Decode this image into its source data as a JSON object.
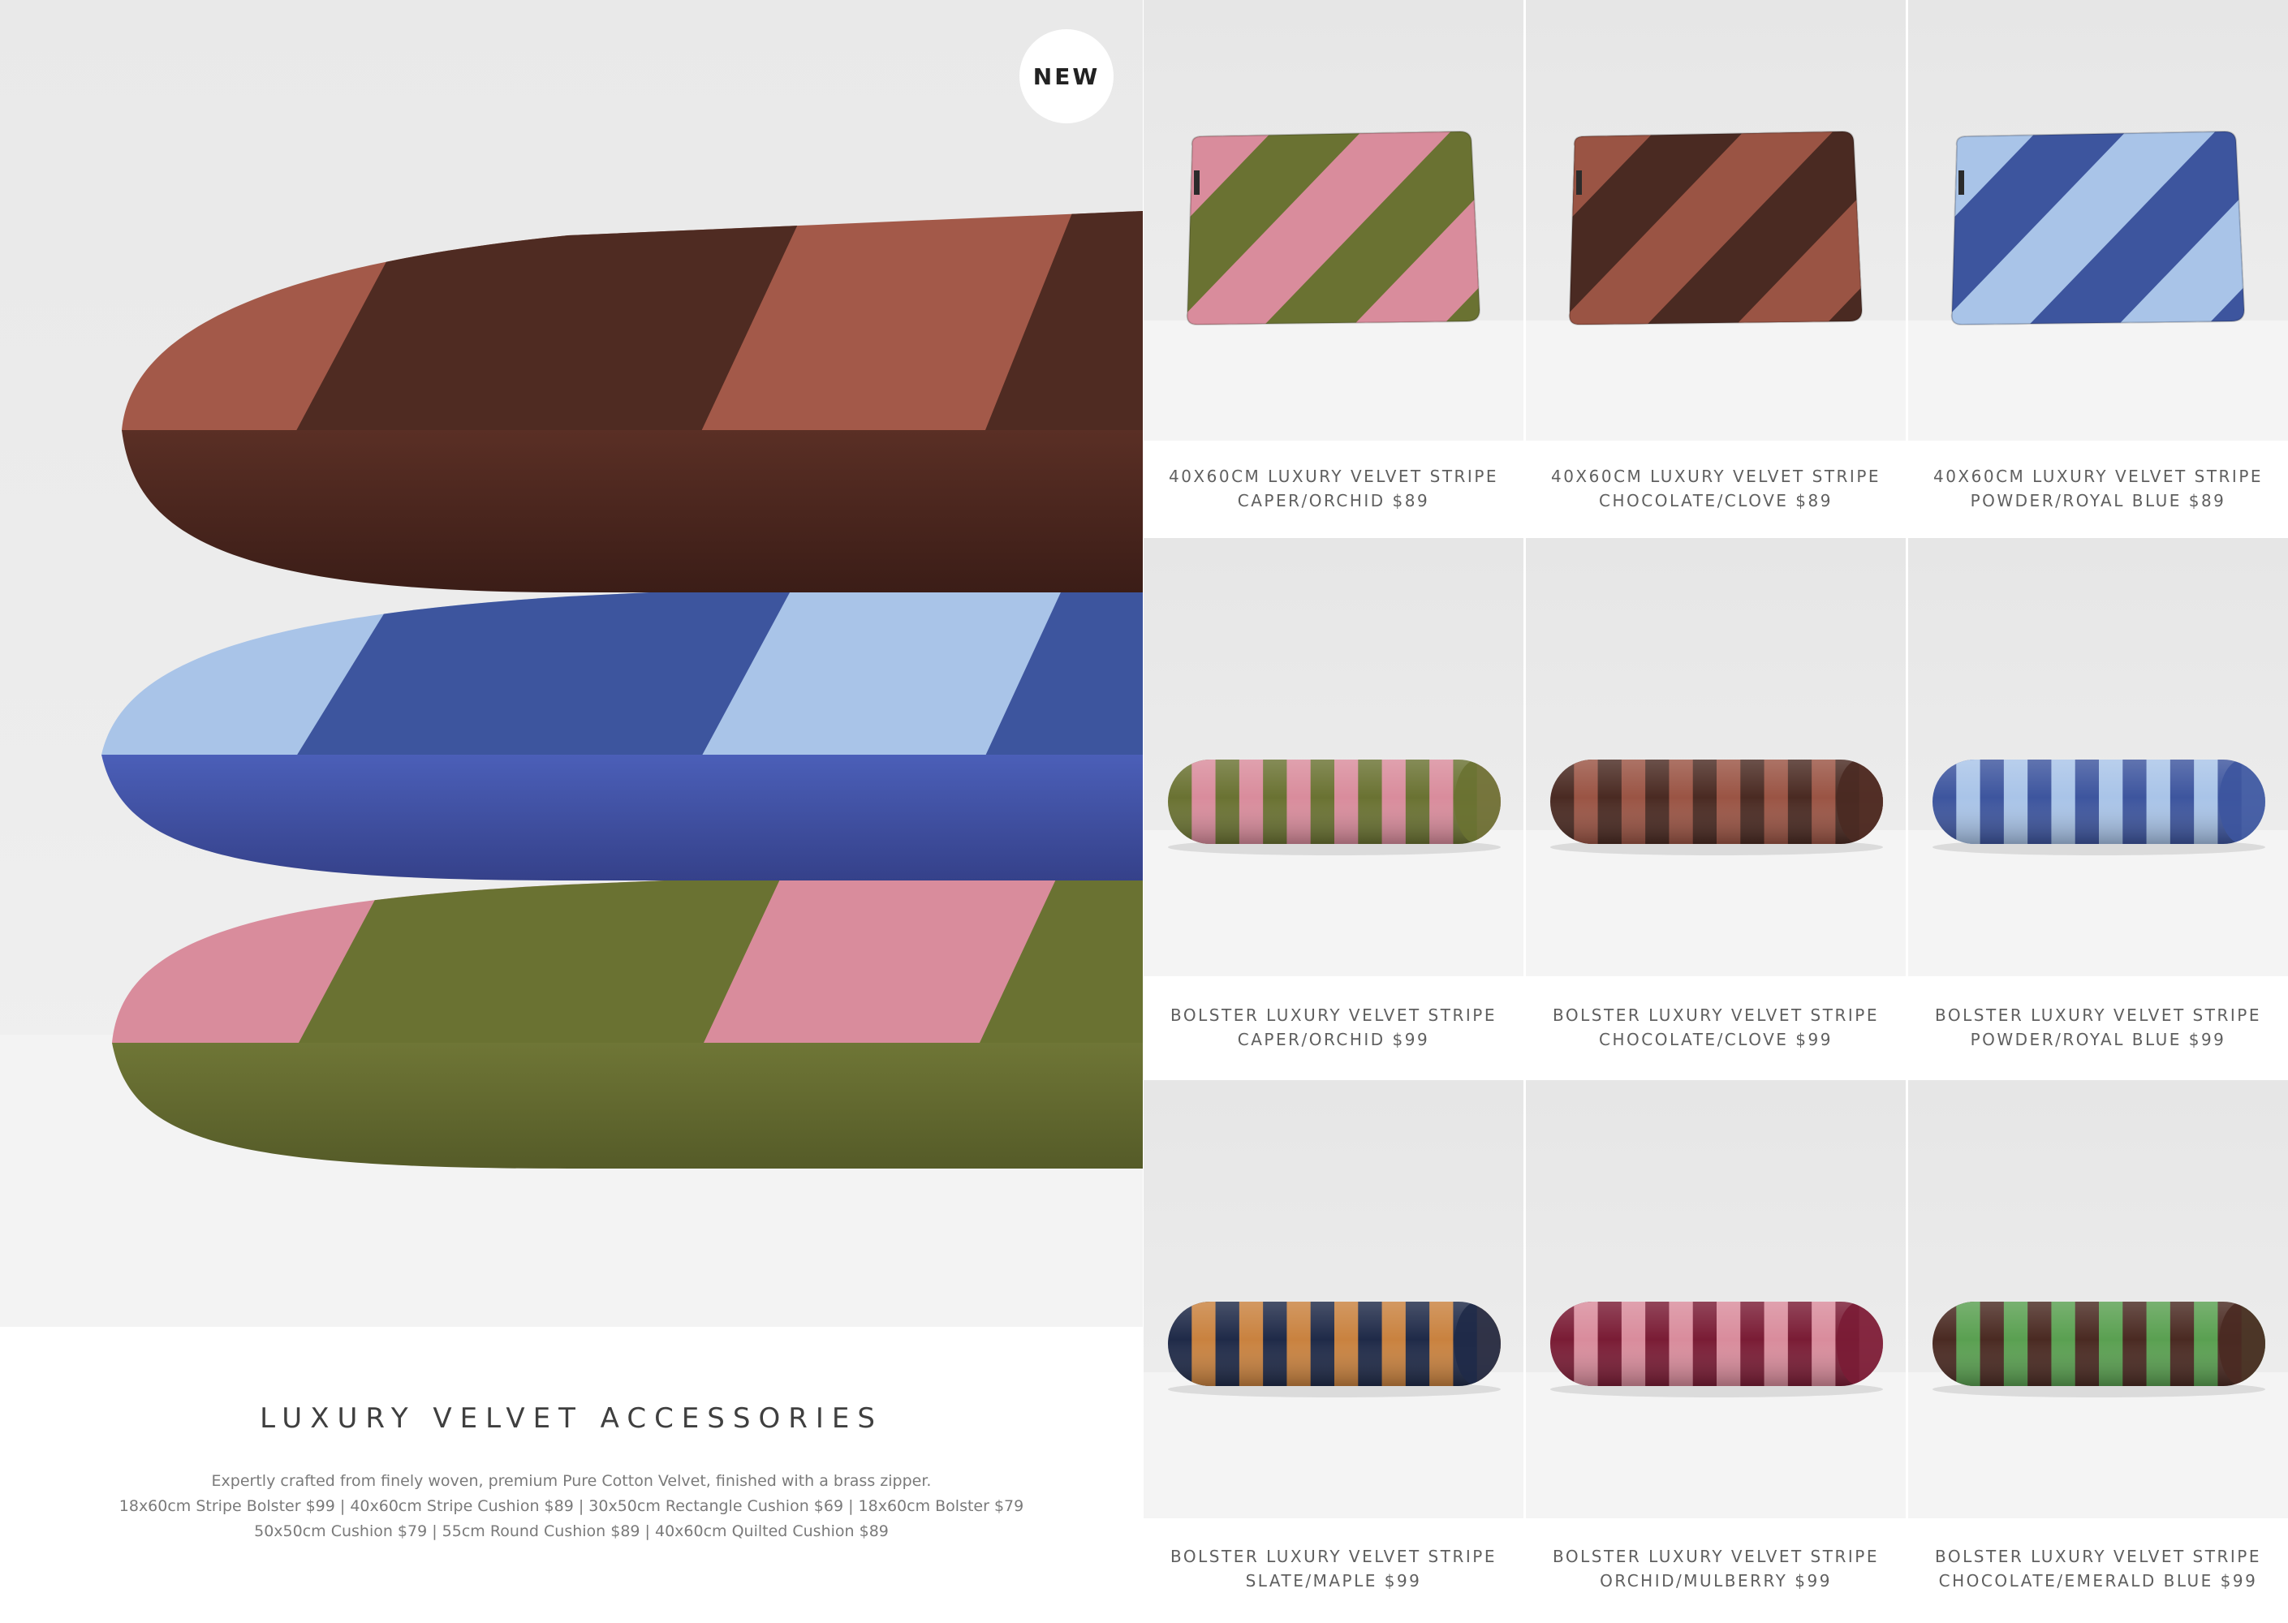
{
  "badge": "NEW",
  "intro": {
    "title": "LUXURY VELVET ACCESSORIES",
    "lines": [
      "Expertly crafted from finely woven, premium Pure Cotton Velvet, finished with a brass zipper.",
      "18x60cm Stripe Bolster $99  |  40x60cm Stripe Cushion $89  |  30x50cm Rectangle Cushion $69 | 18x60cm Bolster $79",
      "50x50cm Cushion $79  |  55cm Round Cushion $89  |  40x60cm Quilted Cushion $89"
    ]
  },
  "products": [
    {
      "line1": "40X60CM LUXURY VELVET STRIPE",
      "line2": "CAPER/ORCHID $89",
      "colors": [
        "#6a7232",
        "#d98c9c"
      ]
    },
    {
      "line1": "40X60CM LUXURY VELVET STRIPE",
      "line2": "CHOCOLATE/CLOVE $89",
      "colors": [
        "#4a2a22",
        "#9a5444"
      ]
    },
    {
      "line1": "40X60CM LUXURY VELVET STRIPE",
      "line2": "POWDER/ROYAL BLUE $89",
      "colors": [
        "#3d559e",
        "#a9c4e8"
      ]
    },
    {
      "line1": "BOLSTER LUXURY VELVET STRIPE",
      "line2": "CAPER/ORCHID $99",
      "colors": [
        "#6a7232",
        "#d98c9c"
      ]
    },
    {
      "line1": "BOLSTER LUXURY VELVET STRIPE",
      "line2": "CHOCOLATE/CLOVE $99",
      "colors": [
        "#4a2a22",
        "#9a5444"
      ]
    },
    {
      "line1": "BOLSTER LUXURY VELVET STRIPE",
      "line2": "POWDER/ROYAL BLUE $99",
      "colors": [
        "#3d559e",
        "#a9c4e8"
      ]
    },
    {
      "line1": "BOLSTER LUXURY VELVET STRIPE",
      "line2": "SLATE/MAPLE $99",
      "colors": [
        "#1f2a48",
        "#c9823f"
      ]
    },
    {
      "line1": "BOLSTER LUXURY VELVET STRIPE",
      "line2": "ORCHID/MULBERRY $99",
      "colors": [
        "#7a1c35",
        "#d98c9c"
      ]
    },
    {
      "line1": "BOLSTER LUXURY VELVET STRIPE",
      "line2": "CHOCOLATE/EMERALD BLUE $99",
      "colors": [
        "#4a2a22",
        "#5aa051"
      ]
    }
  ]
}
